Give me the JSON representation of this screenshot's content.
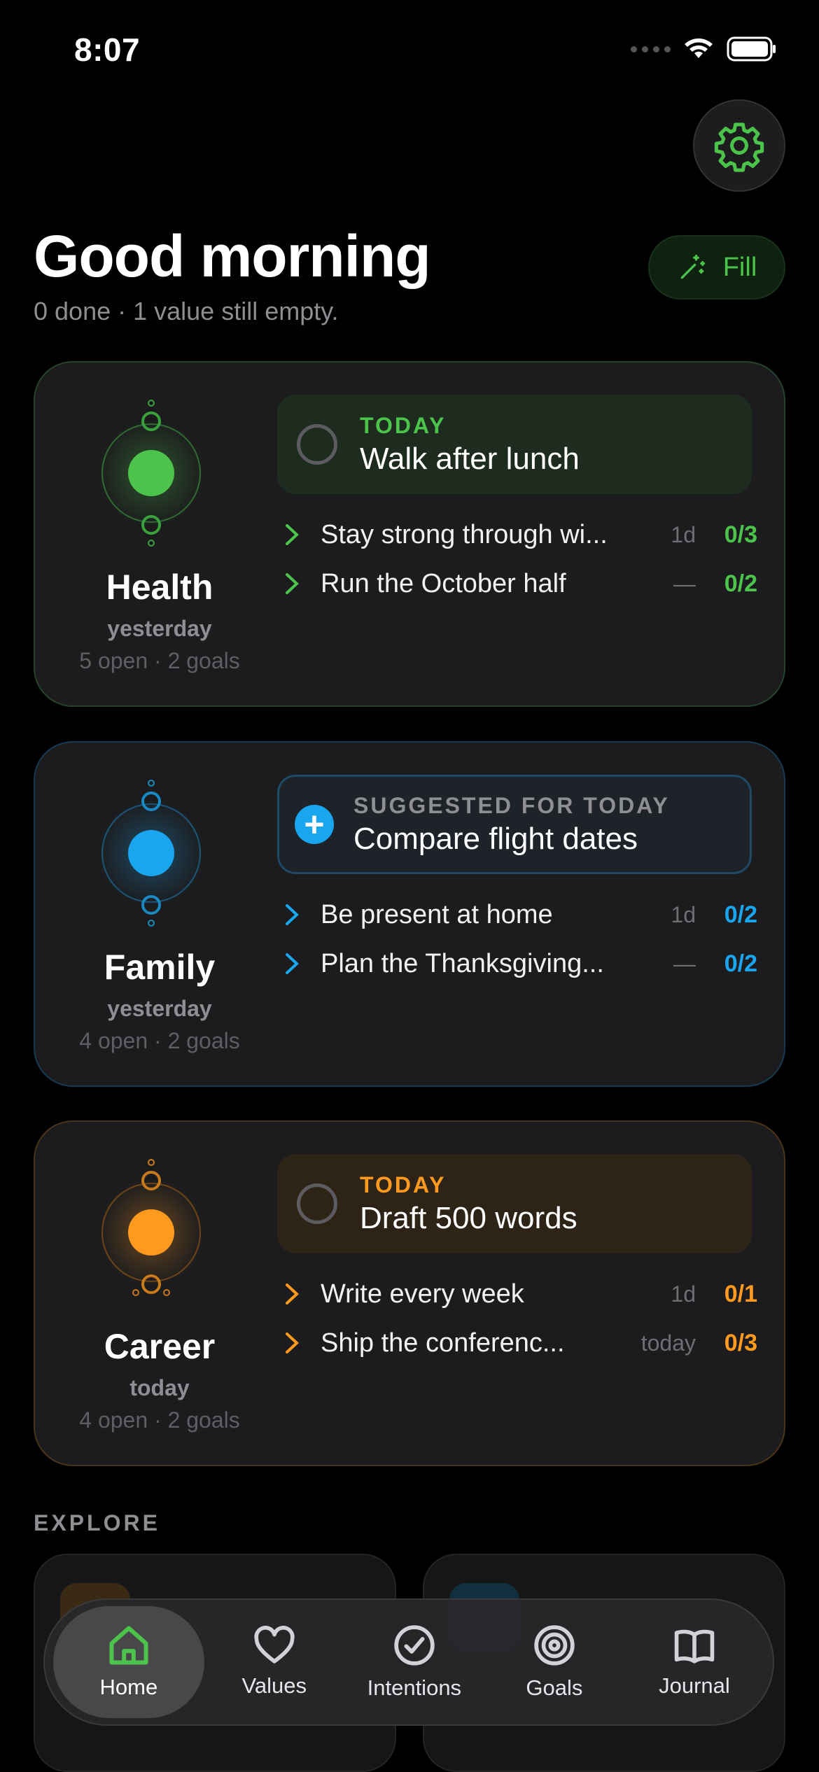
{
  "status_bar": {
    "time": "8:07"
  },
  "header": {
    "greeting": "Good morning",
    "summary": "0 done · 1 value still empty.",
    "fill_label": "Fill"
  },
  "colors": {
    "health": "#4cc44c",
    "family": "#1aa6ee",
    "career": "#ff9a1f"
  },
  "values": {
    "health": {
      "name": "Health",
      "when": "yesterday",
      "stats": "5 open · 2 goals",
      "intention": {
        "kicker": "TODAY",
        "title": "Walk after lunch"
      },
      "goals": [
        {
          "title": "Stay strong through wi...",
          "age": "1d",
          "count": "0/3"
        },
        {
          "title": "Run the October half",
          "age": "—",
          "count": "0/2"
        }
      ]
    },
    "family": {
      "name": "Family",
      "when": "yesterday",
      "stats": "4 open · 2 goals",
      "intention": {
        "kicker": "SUGGESTED FOR TODAY",
        "title": "Compare flight dates"
      },
      "goals": [
        {
          "title": "Be present at home",
          "age": "1d",
          "count": "0/2"
        },
        {
          "title": "Plan the Thanksgiving...",
          "age": "—",
          "count": "0/2"
        }
      ]
    },
    "career": {
      "name": "Career",
      "when": "today",
      "stats": "4 open · 2 goals",
      "intention": {
        "kicker": "TODAY",
        "title": "Draft 500 words"
      },
      "goals": [
        {
          "title": "Write every week",
          "age": "1d",
          "count": "0/1"
        },
        {
          "title": "Ship the conferenc...",
          "age": "today",
          "count": "0/3"
        }
      ]
    }
  },
  "explore": {
    "label": "EXPLORE"
  },
  "tabs": [
    {
      "label": "Home",
      "icon": "home-icon",
      "active": true
    },
    {
      "label": "Values",
      "icon": "heart-icon"
    },
    {
      "label": "Intentions",
      "icon": "check-circle-icon"
    },
    {
      "label": "Goals",
      "icon": "target-icon"
    },
    {
      "label": "Journal",
      "icon": "book-icon"
    }
  ]
}
